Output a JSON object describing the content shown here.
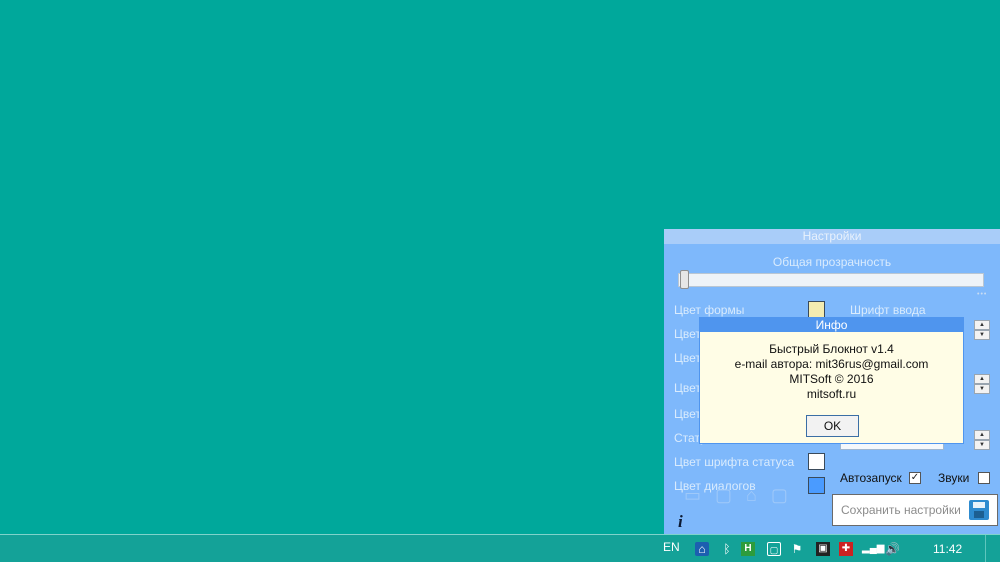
{
  "settings": {
    "title": "Настройки",
    "opacity_label": "Общая прозрачность",
    "opacity_level": 0.0,
    "rows": [
      {
        "label": "Цвет формы",
        "color": "#f3ecb1"
      },
      {
        "label": "Цвет",
        "color": ""
      },
      {
        "label": "Цвет",
        "color": ""
      },
      {
        "label": "Цвет",
        "color": ""
      },
      {
        "label": "Цвет",
        "color": ""
      },
      {
        "label": "Стату",
        "color": ""
      },
      {
        "label": "Цвет шрифта статуса",
        "color": "#ffffff"
      },
      {
        "label": "Цвет диалогов",
        "color": "#4a9bff"
      }
    ],
    "input_font_label": "Шрифт ввода",
    "autostart_label": "Автозапуск",
    "autostart_checked": true,
    "sounds_label": "Звуки",
    "sounds_checked": false,
    "save_label": "Сохранить настройки",
    "info_icon": "i"
  },
  "dialog": {
    "title": "Инфо",
    "lines": [
      "Быстрый Блокнот v1.4",
      "e-mail автора: mit36rus@gmail.com",
      "MITSoft © 2016",
      "mitsoft.ru"
    ],
    "ok_label": "OK"
  },
  "taskbar": {
    "language": "EN",
    "clock": "11:42"
  }
}
